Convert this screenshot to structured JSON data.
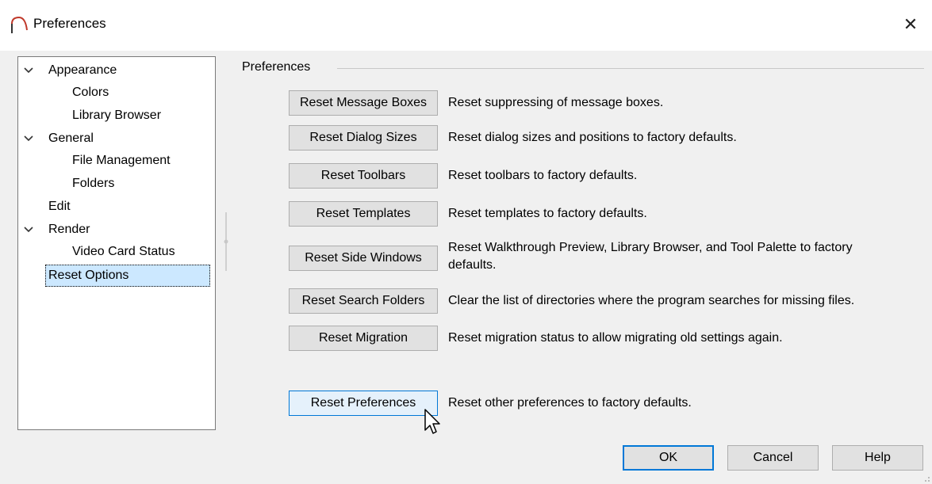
{
  "window": {
    "title": "Preferences",
    "close_glyph": "✕"
  },
  "tree": [
    {
      "label": "Appearance",
      "expanded": true,
      "level": 0
    },
    {
      "label": "Colors",
      "level": 1
    },
    {
      "label": "Library Browser",
      "level": 1
    },
    {
      "label": "General",
      "expanded": true,
      "level": 0
    },
    {
      "label": "File Management",
      "level": 1
    },
    {
      "label": "Folders",
      "level": 1
    },
    {
      "label": "Edit",
      "level": 0
    },
    {
      "label": "Render",
      "expanded": true,
      "level": 0
    },
    {
      "label": "Video Card Status",
      "level": 1
    },
    {
      "label": "Reset Options",
      "level": 0,
      "selected": true
    }
  ],
  "group": {
    "label": "Preferences"
  },
  "actions": [
    {
      "button": "Reset Message Boxes",
      "description": "Reset suppressing of message boxes."
    },
    {
      "button": "Reset Dialog Sizes",
      "description": "Reset dialog sizes and positions to factory defaults."
    },
    {
      "button": "Reset Toolbars",
      "description": "Reset toolbars to factory defaults."
    },
    {
      "button": "Reset Templates",
      "description": "Reset templates to factory defaults."
    },
    {
      "button": "Reset Side Windows",
      "description_line1": "Reset Walkthrough Preview, Library Browser, and Tool Palette to factory",
      "description_line2": "defaults."
    },
    {
      "button": "Reset Search Folders",
      "description": "Clear the list of directories where the program searches for missing files."
    },
    {
      "button": "Reset Migration",
      "description": "Reset migration status to allow migrating old settings again."
    },
    {
      "button": "Reset Preferences",
      "description": "Reset other preferences to factory defaults."
    }
  ],
  "footer": {
    "ok": "OK",
    "cancel": "Cancel",
    "help": "Help"
  },
  "colors": {
    "accent": "#0078d7",
    "selection": "#cce8ff",
    "button_face": "#e1e1e1",
    "icon_arc": "#c0392b"
  }
}
